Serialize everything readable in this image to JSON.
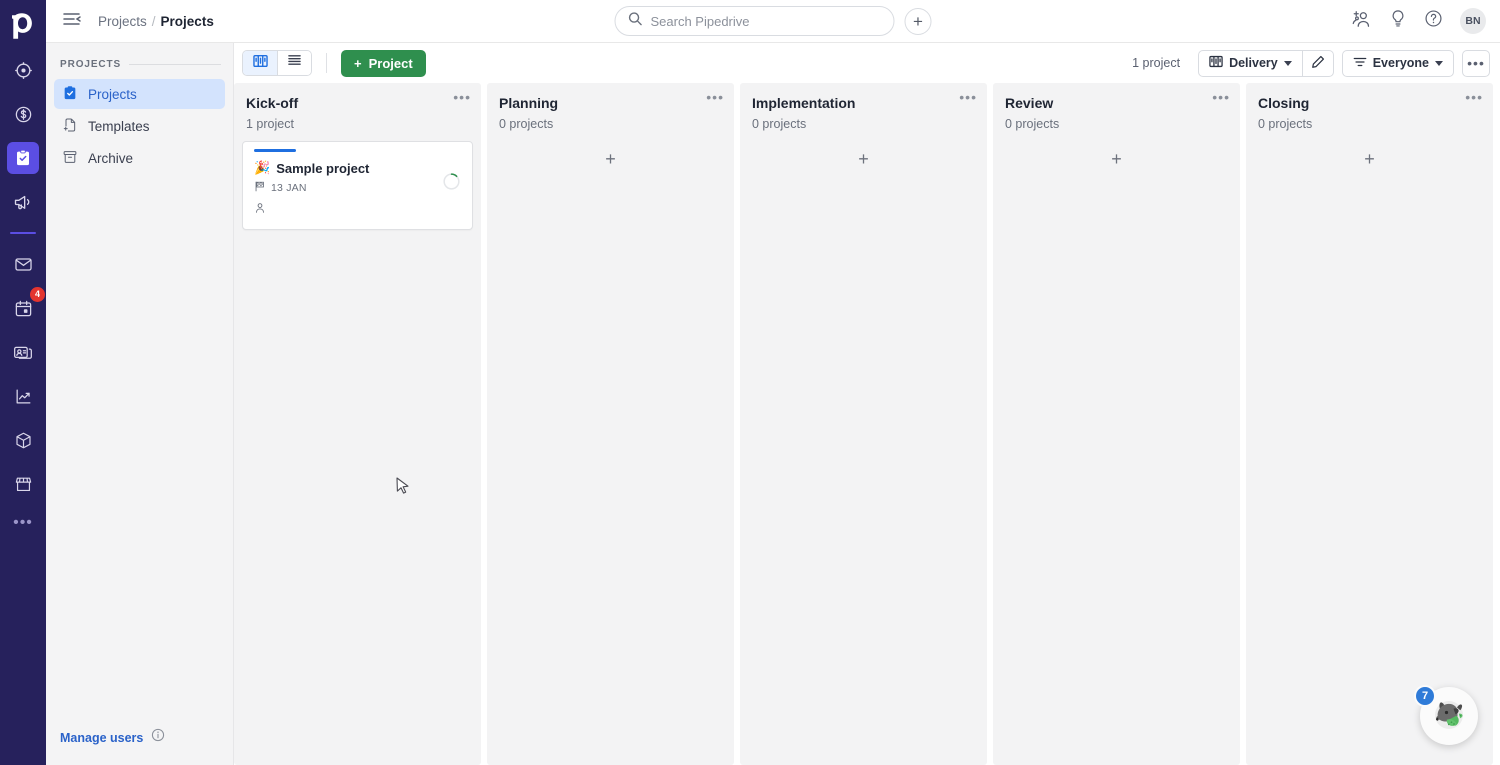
{
  "brand": {
    "logo_text": "p",
    "rail_bg": "#26215c",
    "accent": "#5b4ee3",
    "green": "#2f8f4e",
    "blue": "#2a62c9"
  },
  "rail": {
    "items": [
      {
        "name": "leads-icon",
        "label": "Leads"
      },
      {
        "name": "deals-icon",
        "label": "Deals"
      },
      {
        "name": "projects-icon",
        "label": "Projects",
        "active": true
      },
      {
        "name": "campaigns-icon",
        "label": "Campaigns"
      },
      {
        "name": "mail-icon",
        "label": "Mail"
      },
      {
        "name": "calendar-icon",
        "label": "Activities",
        "badge": "4"
      },
      {
        "name": "contacts-icon",
        "label": "Contacts"
      },
      {
        "name": "insights-icon",
        "label": "Insights"
      },
      {
        "name": "products-icon",
        "label": "Products"
      },
      {
        "name": "marketplace-icon",
        "label": "Marketplace"
      }
    ],
    "more_label": "•••"
  },
  "topbar": {
    "collapse_label": "Collapse menu",
    "breadcrumb": {
      "parent": "Projects",
      "separator": "/",
      "current": "Projects"
    },
    "search": {
      "placeholder": "Search Pipedrive",
      "value": ""
    },
    "add_label": "+",
    "actions": [
      {
        "name": "add-user-icon",
        "label": "Invite users"
      },
      {
        "name": "lightbulb-icon",
        "label": "What's new"
      },
      {
        "name": "help-icon",
        "label": "Help"
      }
    ],
    "avatar_initials": "BN"
  },
  "sidebar": {
    "section_title": "PROJECTS",
    "items": [
      {
        "label": "Projects",
        "icon": "clipboard-check-icon",
        "active": true
      },
      {
        "label": "Templates",
        "icon": "document-plus-icon",
        "active": false
      },
      {
        "label": "Archive",
        "icon": "archive-box-icon",
        "active": false
      }
    ],
    "footer_link": "Manage users",
    "footer_info_icon": "info-icon"
  },
  "toolbar": {
    "view_board_label": "Board view",
    "view_list_label": "List view",
    "add_project_label": "Project",
    "add_project_plus": "+",
    "count_label": "1 project",
    "pipeline_label": "Delivery",
    "edit_label": "Edit pipeline",
    "filter_label": "Everyone",
    "more_label": "•••"
  },
  "board": {
    "columns": [
      {
        "name": "Kick-off",
        "count_label": "1 project",
        "dots": "•••",
        "add_label": "+",
        "cards": [
          {
            "emoji": "🎉",
            "title": "Sample project",
            "date_icon": "flag-checkered-icon",
            "date": "13 JAN",
            "owner_icon": "person-icon",
            "progress_percent": 12
          }
        ]
      },
      {
        "name": "Planning",
        "count_label": "0 projects",
        "dots": "•••",
        "add_label": "+",
        "cards": []
      },
      {
        "name": "Implementation",
        "count_label": "0 projects",
        "dots": "•••",
        "add_label": "+",
        "cards": []
      },
      {
        "name": "Review",
        "count_label": "0 projects",
        "dots": "•••",
        "add_label": "+",
        "cards": []
      },
      {
        "name": "Closing",
        "count_label": "0 projects",
        "dots": "•••",
        "add_label": "+",
        "cards": []
      }
    ]
  },
  "helper": {
    "badge_count": "7",
    "label": "Pipedrive assistant"
  }
}
